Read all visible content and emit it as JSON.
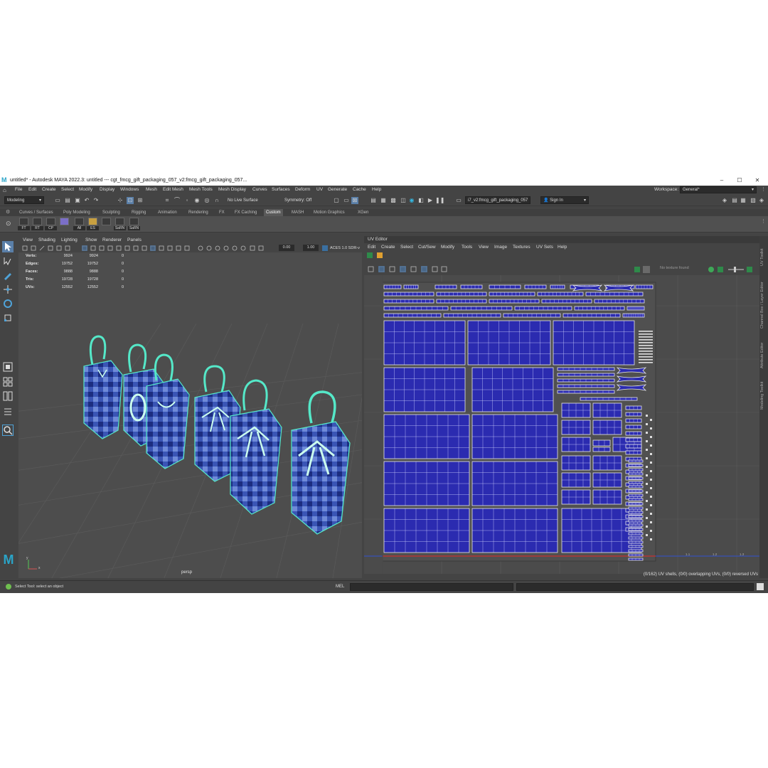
{
  "window": {
    "title": "untitled* - Autodesk MAYA 2022.3: untitled   ---   cgt_fmcg_gift_packaging_057_v2:fmcg_gift_packaging_057...",
    "minimize": "–",
    "maximize": "☐",
    "close": "✕"
  },
  "menubar": {
    "items": [
      "File",
      "Edit",
      "Create",
      "Select",
      "Modify",
      "Display",
      "Windows",
      "Mesh",
      "Edit Mesh",
      "Mesh Tools",
      "Mesh Display",
      "Curves",
      "Surfaces",
      "Deform",
      "UV",
      "Generate",
      "Cache",
      "Help"
    ],
    "workspace_label": "Workspace:",
    "workspace_value": "General*"
  },
  "toolbar": {
    "mode": "Modeling",
    "live_surface": "No Live Surface",
    "symmetry": "Symmetry: Off",
    "scene_field": "i7_v2:fmcg_gift_packaging_057",
    "sign_in": "Sign In"
  },
  "shelf": {
    "tabs": [
      "Curves / Surfaces",
      "Poly Modeling",
      "Sculpting",
      "Rigging",
      "Animation",
      "Rendering",
      "FX",
      "FX Caching",
      "Custom",
      "MASH",
      "Motion Graphics",
      "XGen"
    ],
    "active_tab": "Custom",
    "buttons": [
      "FT",
      "RT",
      "CP",
      "",
      "All",
      "ES",
      "SaRN",
      "SaRN"
    ]
  },
  "viewport": {
    "menu": [
      "View",
      "Shading",
      "Lighting",
      "Show",
      "Renderer",
      "Panels"
    ],
    "exposure": "0.00",
    "gamma": "1.00",
    "colorspace": "ACES 1.0 SDR-v",
    "camera": "persp",
    "hud": [
      {
        "label": "Verts:",
        "a": "9924",
        "b": "9924",
        "c": "0"
      },
      {
        "label": "Edges:",
        "a": "19752",
        "b": "19752",
        "c": "0"
      },
      {
        "label": "Faces:",
        "a": "9888",
        "b": "9888",
        "c": "0"
      },
      {
        "label": "Tris:",
        "a": "19728",
        "b": "19728",
        "c": "0"
      },
      {
        "label": "UVs:",
        "a": "12552",
        "b": "12552",
        "c": "0"
      }
    ],
    "axis_y": "y",
    "axis_x": "x"
  },
  "uv_editor": {
    "title": "UV Editor",
    "menu": [
      "Edit",
      "Create",
      "Select",
      "Cut/Sew",
      "Modify",
      "Tools",
      "View",
      "Image",
      "Textures",
      "UV Sets",
      "Help"
    ],
    "texture_status": "No texture found",
    "status": "(0/162) UV shells, (0/0) overlapping UVs, (0/0) reversed UVs",
    "ticks": [
      "1.1",
      "1.2",
      "1.3"
    ]
  },
  "right_panel_tabs": [
    "UV Toolkit",
    "Channel Box / Layer Editor",
    "Attribute Editor",
    "Modeling Toolkit"
  ],
  "bottom": {
    "help": "Select Tool: select an object",
    "mel": "MEL"
  },
  "colors": {
    "uv_blue": "#2b2bb0",
    "wire_cyan": "#55e8c8",
    "bag_blue": "#3a55b5"
  }
}
